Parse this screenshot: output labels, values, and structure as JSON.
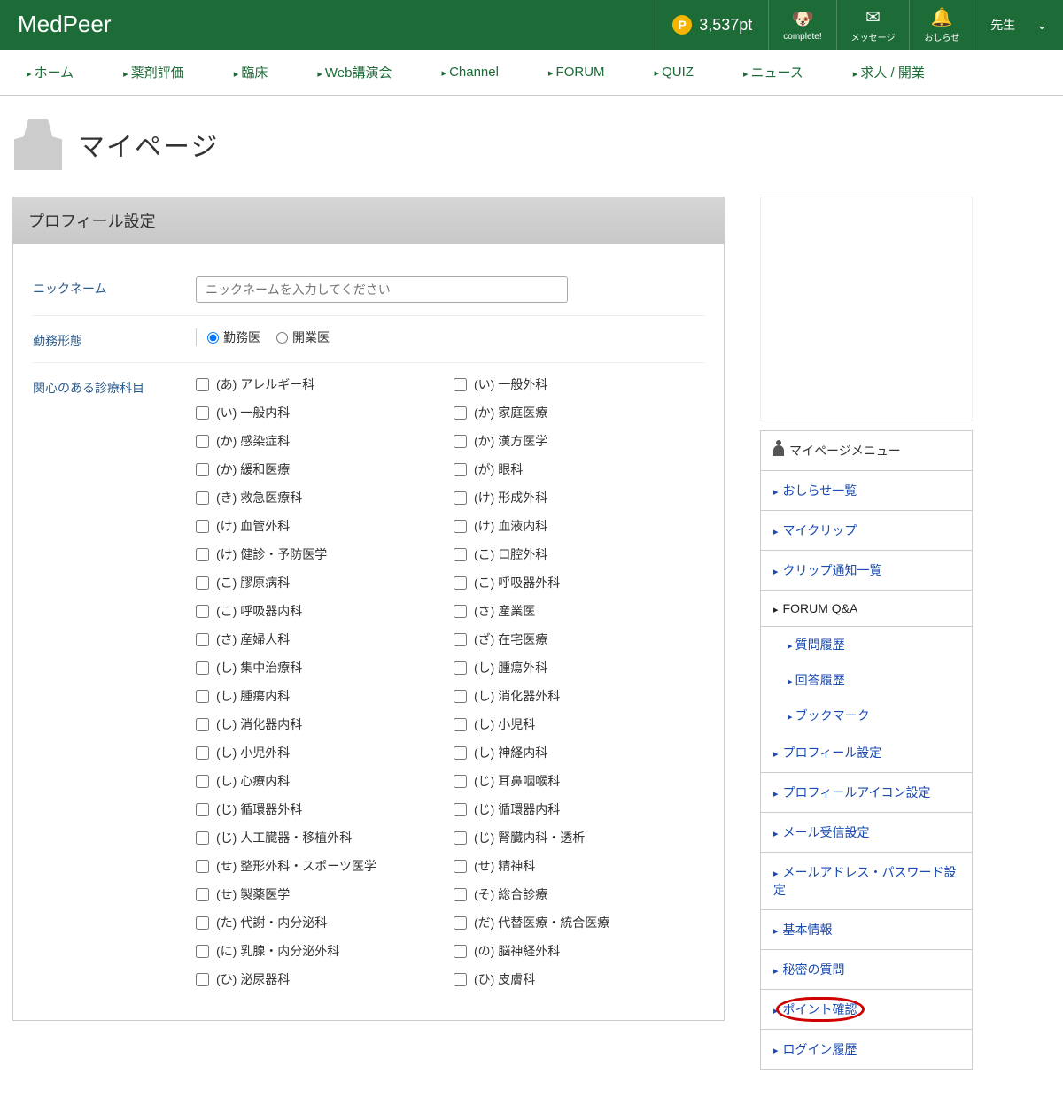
{
  "header": {
    "logo": "MedPeer",
    "points": "3,537pt",
    "complete": "complete!",
    "message": "メッセージ",
    "notice": "おしらせ",
    "user": "先生"
  },
  "nav": [
    "ホーム",
    "薬剤評価",
    "臨床",
    "Web講演会",
    "Channel",
    "FORUM",
    "QUIZ",
    "ニュース",
    "求人 / 開業"
  ],
  "pageTitle": "マイページ",
  "panelTitle": "プロフィール設定",
  "fields": {
    "nickname": {
      "label": "ニックネーム",
      "placeholder": "ニックネームを入力してください"
    },
    "worktype": {
      "label": "勤務形態",
      "opt1": "勤務医",
      "opt2": "開業医"
    },
    "specialties": {
      "label": "関心のある診療科目"
    }
  },
  "specialties": [
    "(あ) アレルギー科",
    "(い) 一般外科",
    "(い) 一般内科",
    "(か) 家庭医療",
    "(か) 感染症科",
    "(か) 漢方医学",
    "(か) 緩和医療",
    "(が) 眼科",
    "(き) 救急医療科",
    "(け) 形成外科",
    "(け) 血管外科",
    "(け) 血液内科",
    "(け) 健診・予防医学",
    "(こ) 口腔外科",
    "(こ) 膠原病科",
    "(こ) 呼吸器外科",
    "(こ) 呼吸器内科",
    "(さ) 産業医",
    "(さ) 産婦人科",
    "(ざ) 在宅医療",
    "(し) 集中治療科",
    "(し) 腫瘍外科",
    "(し) 腫瘍内科",
    "(し) 消化器外科",
    "(し) 消化器内科",
    "(し) 小児科",
    "(し) 小児外科",
    "(し) 神経内科",
    "(し) 心療内科",
    "(じ) 耳鼻咽喉科",
    "(じ) 循環器外科",
    "(じ) 循環器内科",
    "(じ) 人工臓器・移植外科",
    "(じ) 腎臓内科・透析",
    "(せ) 整形外科・スポーツ医学",
    "(せ) 精神科",
    "(せ) 製薬医学",
    "(そ) 総合診療",
    "(た) 代謝・内分泌科",
    "(だ) 代替医療・統合医療",
    "(に) 乳腺・内分泌外科",
    "(の) 脳神経外科",
    "(ひ) 泌尿器科",
    "(ひ) 皮膚科"
  ],
  "sideTitle": "マイページメニュー",
  "sideItems": [
    {
      "label": "おしらせ一覧",
      "link": true
    },
    {
      "label": "マイクリップ",
      "link": true
    },
    {
      "label": "クリップ通知一覧",
      "link": true
    },
    {
      "label": "FORUM Q&A",
      "link": false,
      "subs": [
        "質問履歴",
        "回答履歴",
        "ブックマーク"
      ]
    },
    {
      "label": "プロフィール設定",
      "link": true
    },
    {
      "label": "プロフィールアイコン設定",
      "link": true
    },
    {
      "label": "メール受信設定",
      "link": true
    },
    {
      "label": "メールアドレス・パスワード設定",
      "link": true
    },
    {
      "label": "基本情報",
      "link": true
    },
    {
      "label": "秘密の質問",
      "link": true
    },
    {
      "label": "ポイント確認",
      "link": true,
      "highlight": true
    },
    {
      "label": "ログイン履歴",
      "link": true
    }
  ]
}
